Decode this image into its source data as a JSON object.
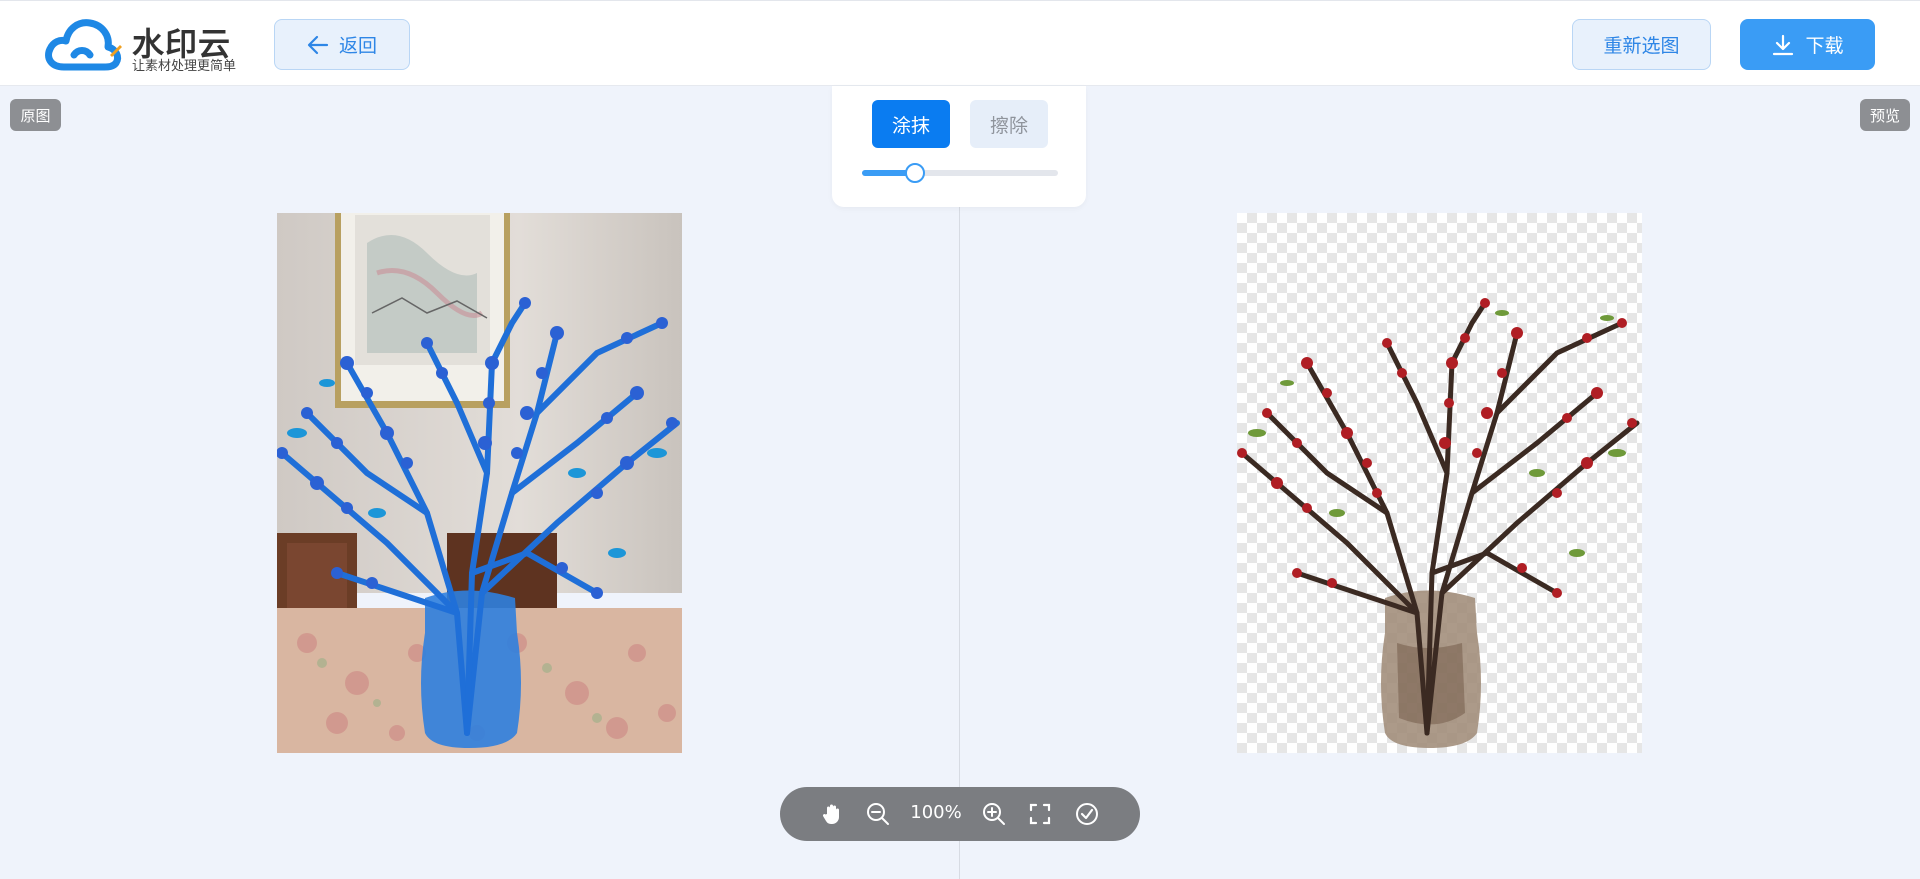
{
  "header": {
    "logo_name": "水印云",
    "logo_tagline": "让素材处理更简单",
    "back_label": "返回",
    "reselect_label": "重新选图",
    "download_label": "下载"
  },
  "labels": {
    "original": "原图",
    "preview": "预览"
  },
  "brush_panel": {
    "paint_label": "涂抹",
    "erase_label": "擦除",
    "active_mode": "paint",
    "brush_size_fraction": 0.27
  },
  "toolbar": {
    "zoom_level": "100%"
  },
  "colors": {
    "accent": "#3a9cf5",
    "primary_button": "#0a7cf1",
    "toolbar_bg": "#7b7d81",
    "canvas_bg": "#eff3fb"
  },
  "icons": {
    "back": "arrow-left-icon",
    "download": "download-icon",
    "hand": "hand-icon",
    "zoom_out": "zoom-out-icon",
    "zoom_in": "zoom-in-icon",
    "fit": "fullscreen-icon",
    "confirm": "check-circle-icon"
  }
}
